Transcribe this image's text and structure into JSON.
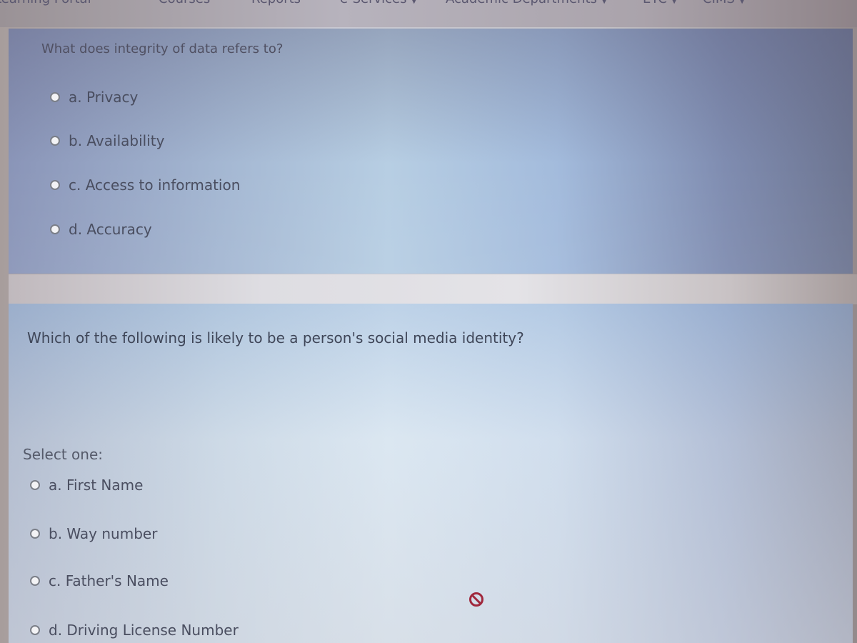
{
  "topnav": {
    "items": [
      {
        "label": "Learning Portal",
        "has_caret": false
      },
      {
        "label": "Courses",
        "has_caret": false
      },
      {
        "label": "Reports",
        "has_caret": false
      },
      {
        "label": "e-Services",
        "has_caret": true
      },
      {
        "label": "Academic Departments",
        "has_caret": true
      },
      {
        "label": "ETC",
        "has_caret": true
      },
      {
        "label": "CIMS",
        "has_caret": true
      }
    ],
    "caret_glyph": "▼"
  },
  "question1": {
    "text": "What does integrity of data refers to?",
    "options": [
      {
        "label": "a. Privacy",
        "selected": false
      },
      {
        "label": "b. Availability",
        "selected": false
      },
      {
        "label": "c. Access to information",
        "selected": false
      },
      {
        "label": "d. Accuracy",
        "selected": false
      }
    ]
  },
  "question2": {
    "text": "Which of the following is likely to be a  person's social media identity?",
    "prompt": "Select one:",
    "options": [
      {
        "label": "a. First Name",
        "selected": false
      },
      {
        "label": "b. Way number",
        "selected": false
      },
      {
        "label": "c. Father's Name",
        "selected": false
      },
      {
        "label": "d. Driving License Number",
        "selected": false
      }
    ]
  },
  "cursor": {
    "icon": "not-allowed-icon",
    "color": "#a0283c"
  }
}
